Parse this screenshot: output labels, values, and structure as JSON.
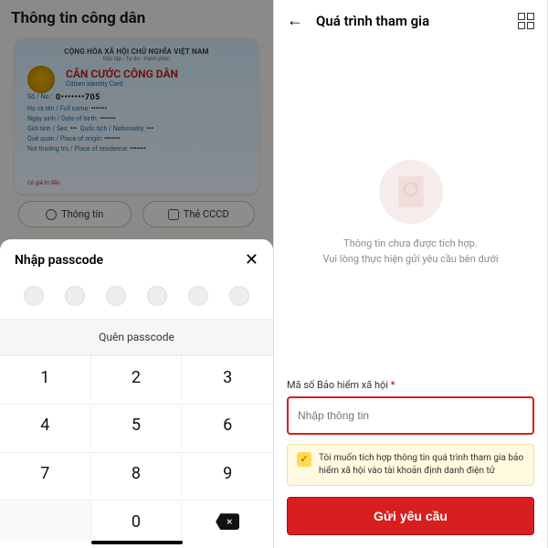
{
  "left": {
    "header": "Thông tin công dân",
    "card": {
      "country": "CỘNG HÒA XÃ HỘI CHỦ NGHĨA VIỆT NAM",
      "motto": "Độc lập - Tự do - Hạnh phúc",
      "title_vi": "CĂN CƯỚC CÔNG DÂN",
      "title_en": "Citizen Identity Card",
      "no_lbl": "Số / No.:",
      "no_val": "0•••••••705",
      "name_lbl": "Họ và tên / Full name:",
      "dob_lbl": "Ngày sinh / Date of birth:",
      "sex_lbl": "Giới tính / Sex:",
      "nat_lbl": "Quốc tịch / Nationality:",
      "origin_lbl": "Quê quán / Place of origin:",
      "res_lbl": "Nơi thường trú / Place of residence:",
      "expiry_lbl": "Có giá trị đến:",
      "dots": "•••••••"
    },
    "tabs": {
      "info": "Thông tin",
      "cccd": "Thẻ CCCD"
    },
    "sheet": {
      "title": "Nhập passcode",
      "forgot": "Quên passcode",
      "keys": [
        "1",
        "2",
        "3",
        "4",
        "5",
        "6",
        "7",
        "8",
        "9",
        "",
        "0",
        "⌫"
      ]
    }
  },
  "right": {
    "title": "Quá trình tham gia",
    "empty1": "Thông tin chưa được tích hợp.",
    "empty2": "Vui lòng thực hiện gửi yêu cầu bên dưới",
    "field_label": "Mã số Bảo hiểm xã hội",
    "required": "*",
    "placeholder": "Nhập thông tin",
    "consent": "Tôi muốn tích hợp thông tin quá trình tham gia bảo hiểm xã hội vào tài khoản định danh điện tử",
    "check": "✓",
    "submit": "Gửi yêu cầu"
  }
}
